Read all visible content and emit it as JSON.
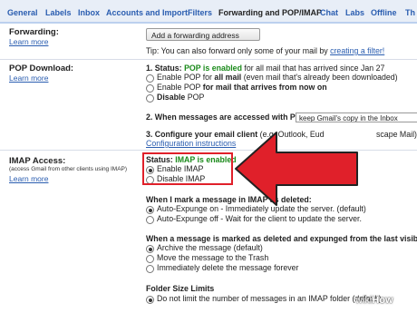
{
  "tabs": [
    "General",
    "Labels",
    "Inbox",
    "Accounts and Import",
    "Filters",
    "Forwarding and POP/IMAP",
    "Chat",
    "Labs",
    "Offline",
    "Th"
  ],
  "forwarding": {
    "label": "Forwarding:",
    "learn_more": "Learn more",
    "button": "Add a forwarding address",
    "tip_prefix": "Tip: You can also forward only some of your mail by",
    "tip_link": "creating a filter!"
  },
  "pop": {
    "label": "POP Download:",
    "learn_more": "Learn more",
    "status_prefix": "1. Status:",
    "status_value": "POP is enabled",
    "status_suffix": "for all mail that has arrived since Jan 27",
    "opt1_a": "Enable POP for",
    "opt1_b": "all mail",
    "opt1_c": "(even mail that's already been downloaded)",
    "opt2_a": "Enable POP",
    "opt2_b": "for mail that arrives from now on",
    "opt3_a": "Disable",
    "opt3_b": "POP",
    "q2": "2. When messages are accessed with POP",
    "q2_select": "keep Gmail's copy in the Inbox",
    "q3_a": "3. Configure your email client",
    "q3_b": "(e.g. Outlook, Eud",
    "q3_c": "scape Mail)",
    "config_link": "Configuration instructions"
  },
  "imap": {
    "label": "IMAP Access:",
    "sublabel": "(access Gmail from other clients using IMAP)",
    "learn_more": "Learn more",
    "status_prefix": "Status:",
    "status_value": "IMAP is enabled",
    "enable": "Enable IMAP",
    "disable": "Disable IMAP",
    "deleted_heading": "When I mark a message in IMAP as deleted:",
    "autoexpunge_on": "Auto-Expunge on - Immediately update the server. (default)",
    "autoexpunge_off": "Auto-Expunge off - Wait for the client to update the server.",
    "expunged_heading": "When a message is marked as deleted and expunged from the last visible IM",
    "archive": "Archive the message (default)",
    "trash": "Move the message to the Trash",
    "delete_forever": "Immediately delete the message forever",
    "folder_heading": "Folder Size Limits",
    "folder_opt": "Do not limit the number of messages in an IMAP folder (default)"
  },
  "watermark": {
    "a": "wiki",
    "b": "How"
  },
  "colors": {
    "accent": "#e0202a",
    "link": "#2a5db0",
    "enabled": "#1a8a1a"
  }
}
